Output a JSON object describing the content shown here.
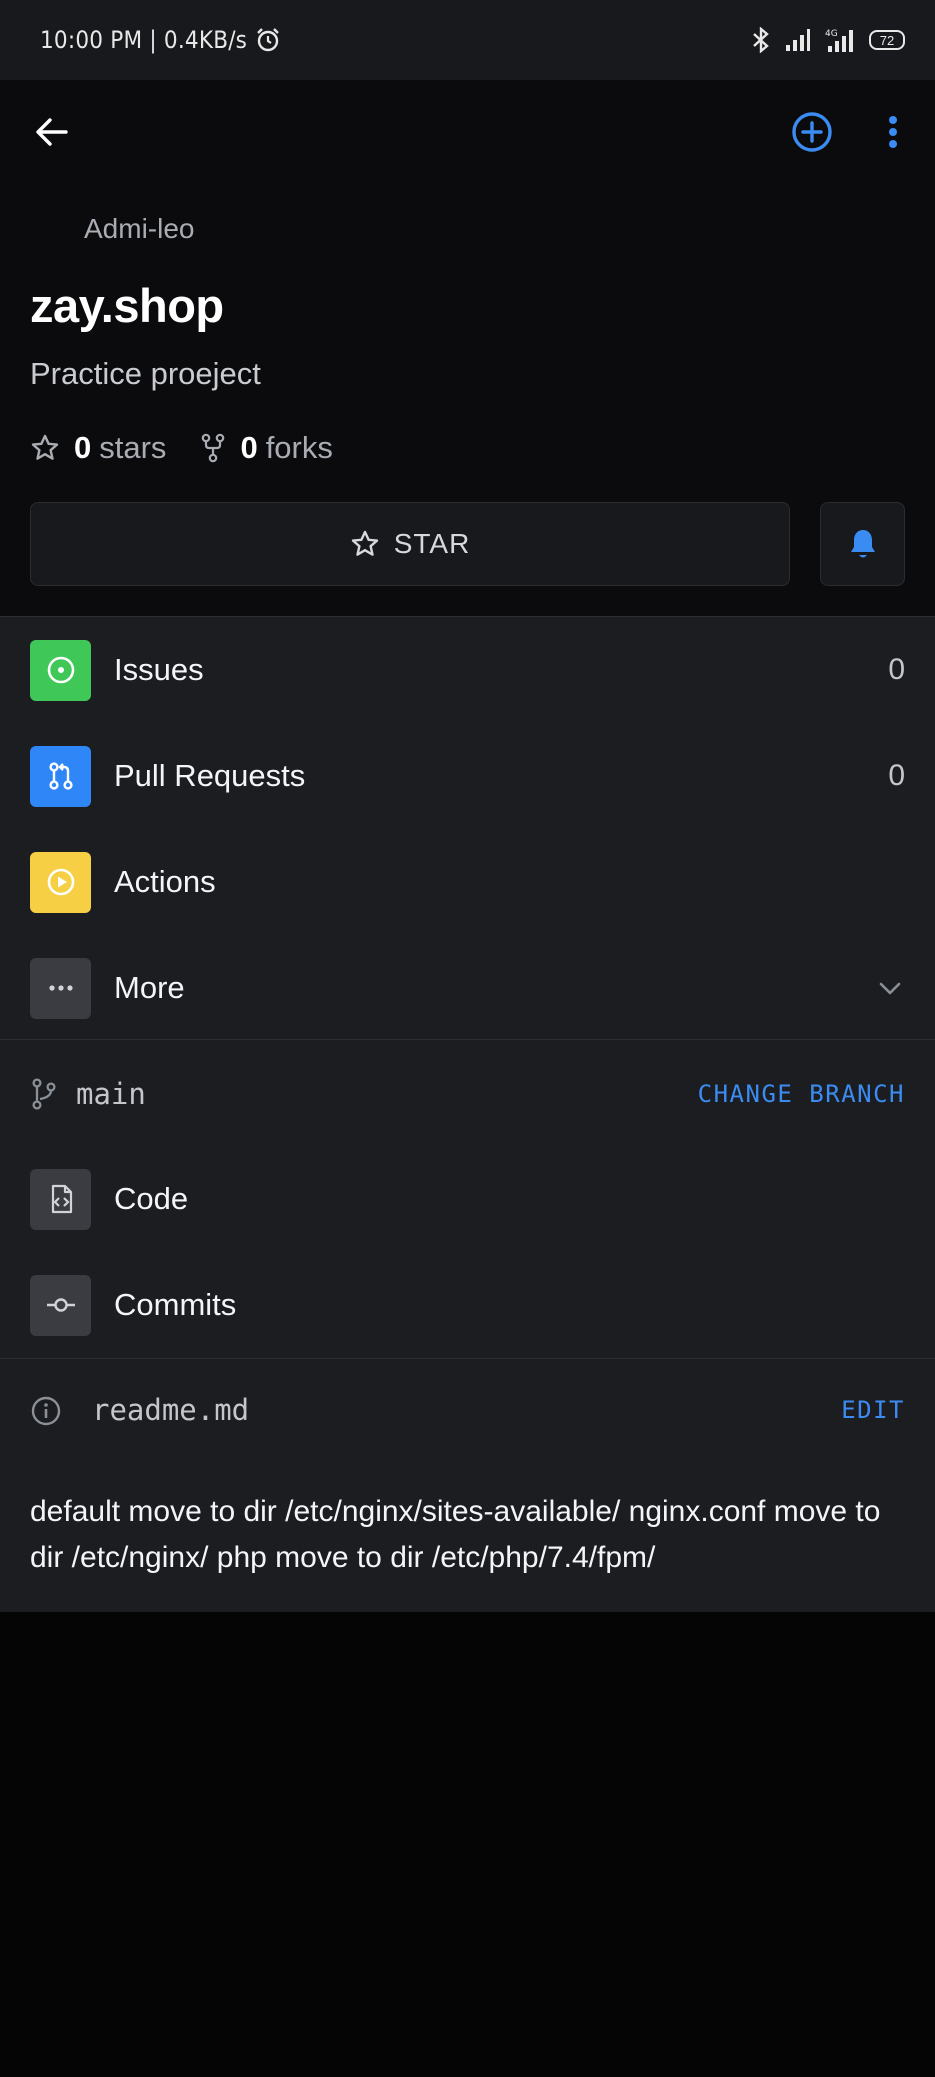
{
  "status_bar": {
    "time_speed": "10:00 PM | 0.4KB/s",
    "battery": "72"
  },
  "repo": {
    "owner": "Admi-leo",
    "name": "zay.shop",
    "description": "Practice proeject",
    "stars_count": "0",
    "stars_label": "stars",
    "forks_count": "0",
    "forks_label": "forks",
    "star_button": "STAR"
  },
  "menu": {
    "items": [
      {
        "label": "Issues",
        "count": "0",
        "color": "#3fc858"
      },
      {
        "label": "Pull Requests",
        "count": "0",
        "color": "#2f87f7"
      },
      {
        "label": "Actions",
        "count": "",
        "color": "#f6cf45"
      },
      {
        "label": "More",
        "count": "",
        "color": "#3a3c42"
      }
    ]
  },
  "branch": {
    "name": "main",
    "change_label": "CHANGE BRANCH"
  },
  "code_items": [
    {
      "label": "Code"
    },
    {
      "label": "Commits"
    }
  ],
  "readme": {
    "filename": "readme.md",
    "edit_label": "EDIT",
    "content": "default move to dir /etc/nginx/sites-available/ nginx.conf move to dir /etc/nginx/ php move to dir /etc/php/7.4/fpm/"
  },
  "colors": {
    "accent": "#3b8cf2",
    "background": "#1c1d21",
    "header": "#0b0b0d"
  }
}
